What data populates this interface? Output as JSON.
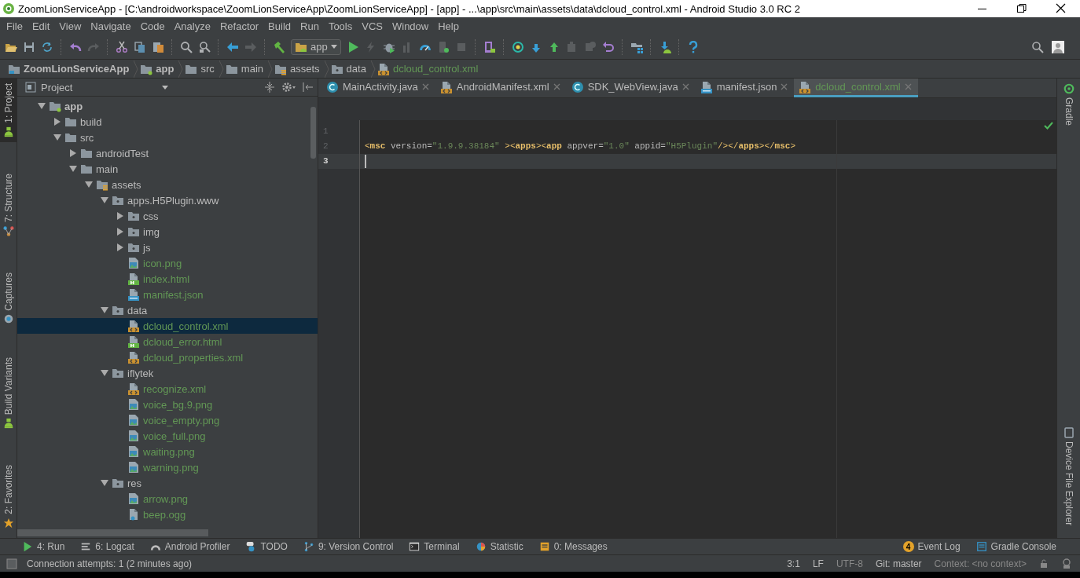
{
  "window": {
    "title": "ZoomLionServiceApp - [C:\\androidworkspace\\ZoomLionServiceApp\\ZoomLionServiceApp] - [app] - ...\\app\\src\\main\\assets\\data\\dcloud_control.xml - Android Studio 3.0 RC 2"
  },
  "menu": [
    "File",
    "Edit",
    "View",
    "Navigate",
    "Code",
    "Analyze",
    "Refactor",
    "Build",
    "Run",
    "Tools",
    "VCS",
    "Window",
    "Help"
  ],
  "toolbar": {
    "run_config": "app"
  },
  "breadcrumbs": [
    {
      "label": "ZoomLionServiceApp",
      "kind": "project"
    },
    {
      "label": "app",
      "kind": "module"
    },
    {
      "label": "src",
      "kind": "folder"
    },
    {
      "label": "main",
      "kind": "folder"
    },
    {
      "label": "assets",
      "kind": "assets"
    },
    {
      "label": "data",
      "kind": "package"
    },
    {
      "label": "dcloud_control.xml",
      "kind": "xml"
    }
  ],
  "left_strip": {
    "top": [
      {
        "label": "1: Project",
        "selected": true,
        "kind": "android"
      },
      {
        "label": "7: Structure",
        "selected": false,
        "kind": "structure"
      },
      {
        "label": "Captures",
        "selected": false,
        "kind": "capture"
      }
    ],
    "bottom": [
      {
        "label": "Build Variants",
        "selected": false,
        "kind": "android"
      },
      {
        "label": "2: Favorites",
        "selected": false,
        "kind": "star"
      }
    ]
  },
  "right_strip": {
    "top": [
      "Gradle"
    ],
    "bottom": [
      "Device File Explorer"
    ]
  },
  "project_panel": {
    "title": "Project",
    "tree": [
      {
        "label": "app",
        "kind": "module",
        "expanded": true,
        "selected": false,
        "children": [
          {
            "label": "build",
            "kind": "folder",
            "expanded": false,
            "selected": false
          },
          {
            "label": "src",
            "kind": "folder",
            "expanded": true,
            "selected": false,
            "children": [
              {
                "label": "androidTest",
                "kind": "folder",
                "expanded": false,
                "selected": false
              },
              {
                "label": "main",
                "kind": "folder",
                "expanded": true,
                "selected": false,
                "children": [
                  {
                    "label": "assets",
                    "kind": "assets",
                    "expanded": true,
                    "selected": false,
                    "children": [
                      {
                        "label": "apps.H5Plugin.www",
                        "kind": "package",
                        "expanded": true,
                        "selected": false,
                        "children": [
                          {
                            "label": "css",
                            "kind": "package",
                            "expanded": false,
                            "selected": false
                          },
                          {
                            "label": "img",
                            "kind": "package",
                            "expanded": false,
                            "selected": false
                          },
                          {
                            "label": "js",
                            "kind": "package",
                            "expanded": false,
                            "selected": false
                          },
                          {
                            "label": "icon.png",
                            "kind": "image",
                            "selected": false
                          },
                          {
                            "label": "index.html",
                            "kind": "html",
                            "selected": false
                          },
                          {
                            "label": "manifest.json",
                            "kind": "json",
                            "selected": false
                          }
                        ]
                      },
                      {
                        "label": "data",
                        "kind": "package",
                        "expanded": true,
                        "selected": false,
                        "children": [
                          {
                            "label": "dcloud_control.xml",
                            "kind": "xml",
                            "selected": true
                          },
                          {
                            "label": "dcloud_error.html",
                            "kind": "html",
                            "selected": false
                          },
                          {
                            "label": "dcloud_properties.xml",
                            "kind": "xml",
                            "selected": false
                          }
                        ]
                      },
                      {
                        "label": "iflytek",
                        "kind": "package",
                        "expanded": true,
                        "selected": false,
                        "children": [
                          {
                            "label": "recognize.xml",
                            "kind": "xml",
                            "selected": false
                          },
                          {
                            "label": "voice_bg.9.png",
                            "kind": "image",
                            "selected": false
                          },
                          {
                            "label": "voice_empty.png",
                            "kind": "image",
                            "selected": false
                          },
                          {
                            "label": "voice_full.png",
                            "kind": "image",
                            "selected": false
                          },
                          {
                            "label": "waiting.png",
                            "kind": "image",
                            "selected": false
                          },
                          {
                            "label": "warning.png",
                            "kind": "image",
                            "selected": false
                          }
                        ]
                      },
                      {
                        "label": "res",
                        "kind": "package",
                        "expanded": true,
                        "selected": false,
                        "children": [
                          {
                            "label": "arrow.png",
                            "kind": "image",
                            "selected": false
                          },
                          {
                            "label": "beep.ogg",
                            "kind": "audio",
                            "selected": false
                          }
                        ]
                      }
                    ]
                  }
                ]
              }
            ]
          }
        ]
      }
    ]
  },
  "editor": {
    "tabs": [
      {
        "label": "MainActivity.java",
        "kind": "java",
        "selected": false
      },
      {
        "label": "AndroidManifest.xml",
        "kind": "xml",
        "selected": false
      },
      {
        "label": "SDK_WebView.java",
        "kind": "java",
        "selected": false
      },
      {
        "label": "manifest.json",
        "kind": "json",
        "selected": false
      },
      {
        "label": "dcloud_control.xml",
        "kind": "xml",
        "selected": true
      }
    ],
    "lines": [
      {
        "number": "1",
        "current": false
      },
      {
        "number": "2",
        "current": false,
        "tokens": [
          {
            "text": "<",
            "kind": "bracket"
          },
          {
            "text": "msc",
            "kind": "tag"
          },
          {
            "text": " version=",
            "kind": "attr"
          },
          {
            "text": "\"1.9.9.38184\"",
            "kind": "value"
          },
          {
            "text": " >",
            "kind": "bracket"
          },
          {
            "text": "<",
            "kind": "bracket"
          },
          {
            "text": "apps",
            "kind": "tag"
          },
          {
            "text": ">",
            "kind": "bracket"
          },
          {
            "text": "<",
            "kind": "bracket"
          },
          {
            "text": "app",
            "kind": "tag"
          },
          {
            "text": " appver=",
            "kind": "attr"
          },
          {
            "text": "\"1.0\"",
            "kind": "value"
          },
          {
            "text": " appid=",
            "kind": "attr"
          },
          {
            "text": "\"H5Plugin\"",
            "kind": "value"
          },
          {
            "text": "/></",
            "kind": "bracket"
          },
          {
            "text": "apps",
            "kind": "tag"
          },
          {
            "text": "></",
            "kind": "bracket"
          },
          {
            "text": "msc",
            "kind": "tag"
          },
          {
            "text": ">",
            "kind": "bracket"
          }
        ]
      },
      {
        "number": "3",
        "current": true
      }
    ]
  },
  "bottom_tools": {
    "left": [
      {
        "label": "4: Run",
        "kind": "run"
      },
      {
        "label": "6: Logcat",
        "kind": "logcat"
      },
      {
        "label": "Android Profiler",
        "kind": "profiler"
      },
      {
        "label": "TODO",
        "kind": "todo"
      },
      {
        "label": "9: Version Control",
        "kind": "vcs"
      },
      {
        "label": "Terminal",
        "kind": "terminal"
      },
      {
        "label": "Statistic",
        "kind": "statistic"
      },
      {
        "label": "0: Messages",
        "kind": "messages"
      }
    ],
    "right": [
      {
        "label": "Event Log",
        "kind": "events",
        "badge": "4"
      },
      {
        "label": "Gradle Console",
        "kind": "console"
      }
    ]
  },
  "status_bar": {
    "message": "Connection attempts: 1 (2 minutes ago)",
    "position": "3:1",
    "line_separator": "LF",
    "encoding": "UTF-8",
    "vcs_branch": "Git: master",
    "context": "Context: <no context>"
  }
}
